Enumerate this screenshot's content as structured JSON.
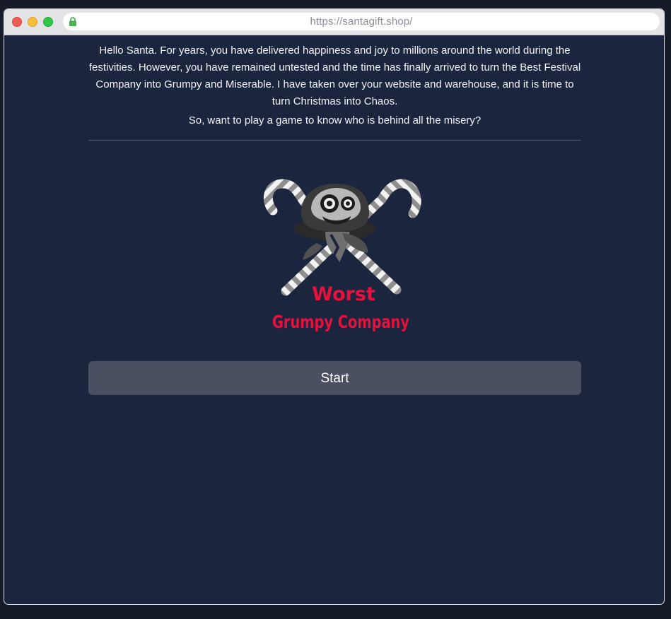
{
  "browser": {
    "url": "https://santagift.shop/"
  },
  "main": {
    "intro_text": "Hello Santa. For years, you have delivered happiness and joy to millions around the world during the festivities. However, you have remained untested and the time has finally arrived to turn the Best Festival Company into Grumpy and Miserable. I have taken over your website and warehouse, and it is time to turn Christmas into Chaos.",
    "question_text": "So, want to play a game to know who is behind all the misery?",
    "logo": {
      "line1": "Worst",
      "line2": "Grumpy Company",
      "text_color": "#e8103c"
    },
    "start_label": "Start"
  },
  "colors": {
    "page_bg": "#1b253d",
    "button_bg": "#4a5061",
    "text": "#f2f4f8"
  }
}
